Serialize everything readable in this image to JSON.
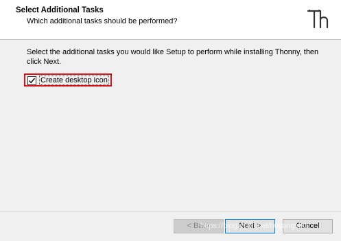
{
  "header": {
    "title": "Select Additional Tasks",
    "subtitle": "Which additional tasks should be performed?",
    "logo_icon": "thonny-logo-icon"
  },
  "main": {
    "instruction": "Select the additional tasks you would like Setup to perform while installing Thonny, then click Next.",
    "tasks": [
      {
        "label": "Create desktop icon",
        "checked": true
      }
    ],
    "highlight_color": "#e0101a"
  },
  "footer": {
    "back_label": "< Back",
    "next_label": "Next >",
    "cancel_label": "Cancel",
    "watermark": "https://blog.csdn.net/huyangshu"
  }
}
